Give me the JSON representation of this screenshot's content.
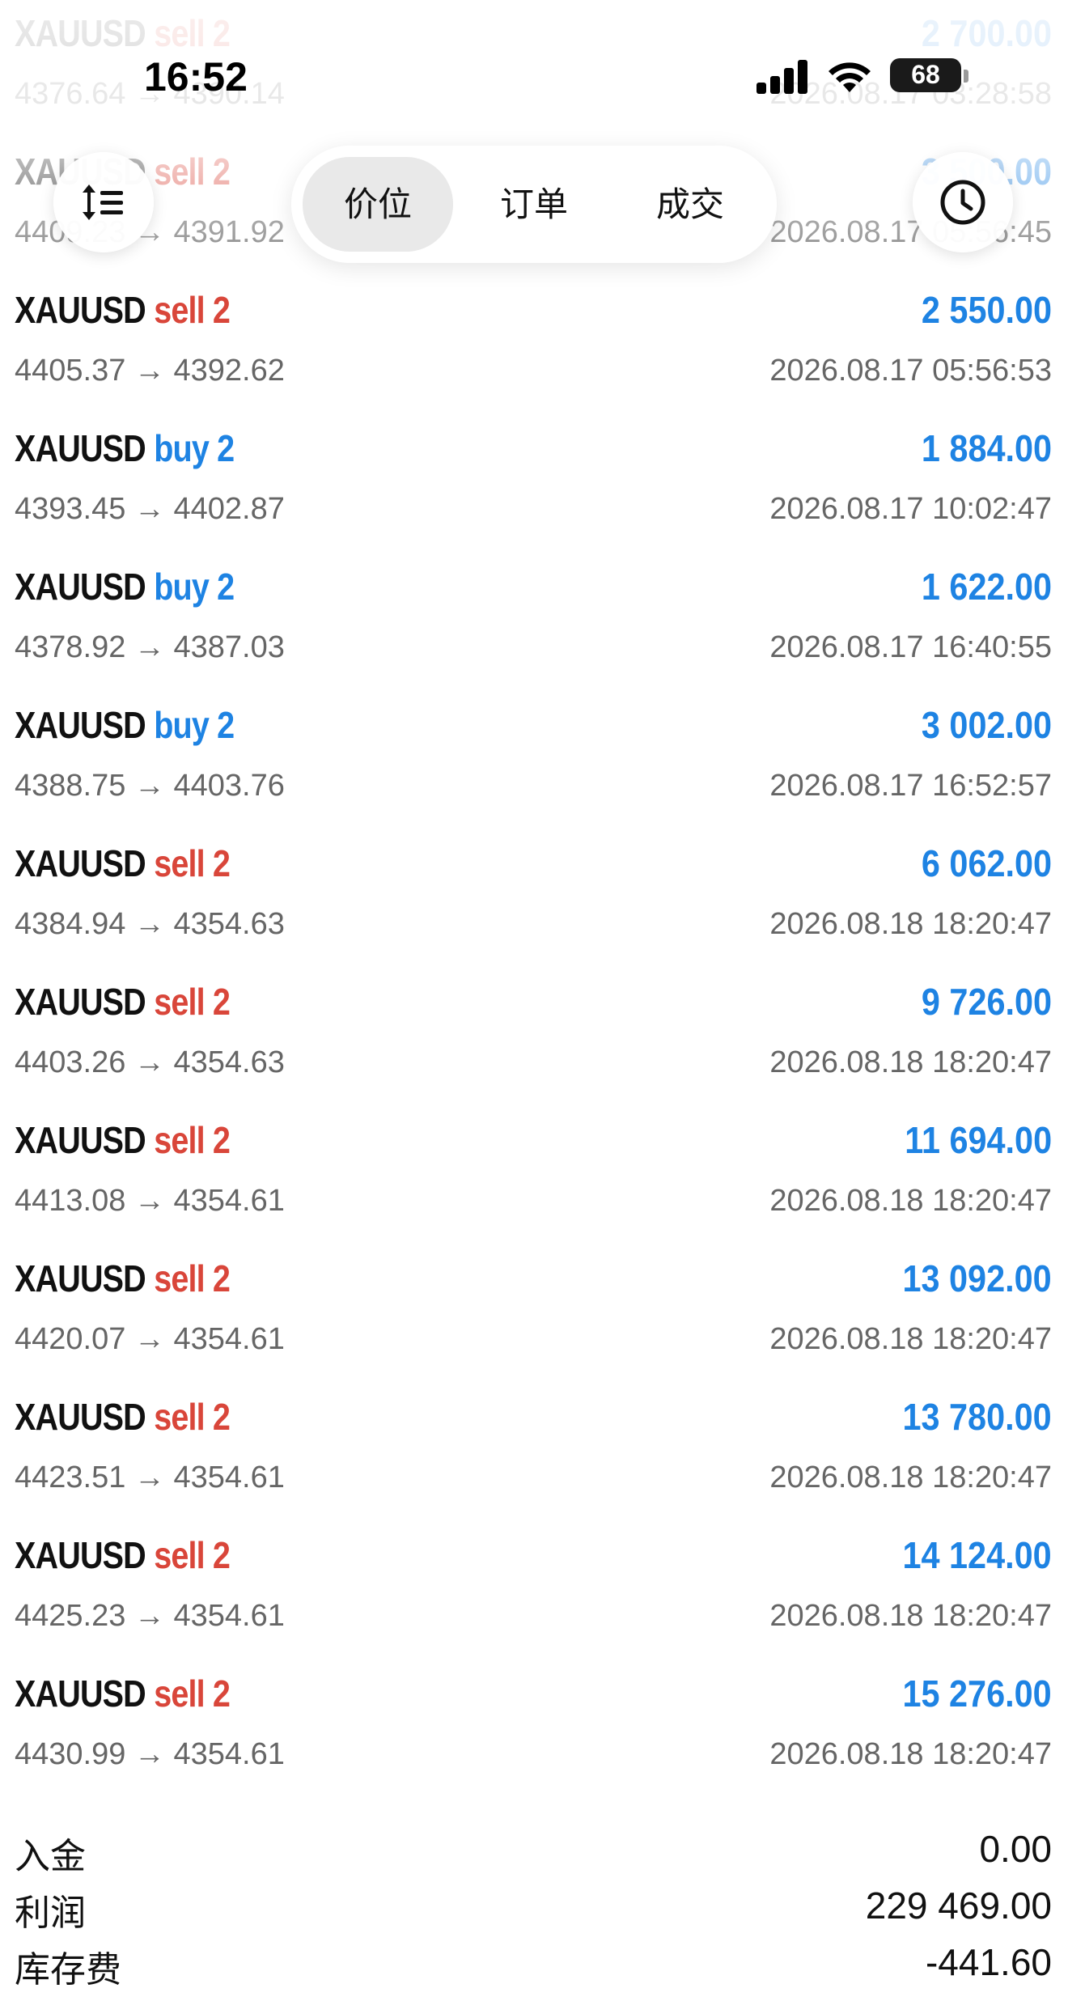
{
  "status_bar": {
    "time": "16:52",
    "battery": "68"
  },
  "tabs": [
    {
      "label": "价位",
      "active": true
    },
    {
      "label": "订单",
      "active": false
    },
    {
      "label": "成交",
      "active": false
    }
  ],
  "toolbar": {
    "left_icon": "sort-icon",
    "right_icon": "history-clock-icon"
  },
  "deals": [
    {
      "symbol": "XAUUSD",
      "side": "sell",
      "volume": "2",
      "profit": "2 700.00",
      "prices": "4376.64 → 4390.14",
      "time": "2026.08.17 03:28:58"
    },
    {
      "symbol": "XAUUSD",
      "side": "sell",
      "volume": "2",
      "profit": "3 500.00",
      "prices": "4409.23 → 4391.92",
      "time": "2026.08.17 05:56:45"
    },
    {
      "symbol": "XAUUSD",
      "side": "sell",
      "volume": "2",
      "profit": "2 550.00",
      "prices": "4405.37 → 4392.62",
      "time": "2026.08.17 05:56:53"
    },
    {
      "symbol": "XAUUSD",
      "side": "buy",
      "volume": "2",
      "profit": "1 884.00",
      "prices": "4393.45 → 4402.87",
      "time": "2026.08.17 10:02:47"
    },
    {
      "symbol": "XAUUSD",
      "side": "buy",
      "volume": "2",
      "profit": "1 622.00",
      "prices": "4378.92 → 4387.03",
      "time": "2026.08.17 16:40:55"
    },
    {
      "symbol": "XAUUSD",
      "side": "buy",
      "volume": "2",
      "profit": "3 002.00",
      "prices": "4388.75 → 4403.76",
      "time": "2026.08.17 16:52:57"
    },
    {
      "symbol": "XAUUSD",
      "side": "sell",
      "volume": "2",
      "profit": "6 062.00",
      "prices": "4384.94 → 4354.63",
      "time": "2026.08.18 18:20:47"
    },
    {
      "symbol": "XAUUSD",
      "side": "sell",
      "volume": "2",
      "profit": "9 726.00",
      "prices": "4403.26 → 4354.63",
      "time": "2026.08.18 18:20:47"
    },
    {
      "symbol": "XAUUSD",
      "side": "sell",
      "volume": "2",
      "profit": "11 694.00",
      "prices": "4413.08 → 4354.61",
      "time": "2026.08.18 18:20:47"
    },
    {
      "symbol": "XAUUSD",
      "side": "sell",
      "volume": "2",
      "profit": "13 092.00",
      "prices": "4420.07 → 4354.61",
      "time": "2026.08.18 18:20:47"
    },
    {
      "symbol": "XAUUSD",
      "side": "sell",
      "volume": "2",
      "profit": "13 780.00",
      "prices": "4423.51 → 4354.61",
      "time": "2026.08.18 18:20:47"
    },
    {
      "symbol": "XAUUSD",
      "side": "sell",
      "volume": "2",
      "profit": "14 124.00",
      "prices": "4425.23 → 4354.61",
      "time": "2026.08.18 18:20:47"
    },
    {
      "symbol": "XAUUSD",
      "side": "sell",
      "volume": "2",
      "profit": "15 276.00",
      "prices": "4430.99 → 4354.61",
      "time": "2026.08.18 18:20:47"
    }
  ],
  "summary": [
    {
      "label": "入金",
      "value": "0.00"
    },
    {
      "label": "利润",
      "value": "229 469.00"
    },
    {
      "label": "库存费",
      "value": "-441.60"
    }
  ],
  "colors": {
    "sell": "#d9463a",
    "buy": "#1e83e3",
    "profit": "#1e83e3",
    "muted": "#666666"
  }
}
